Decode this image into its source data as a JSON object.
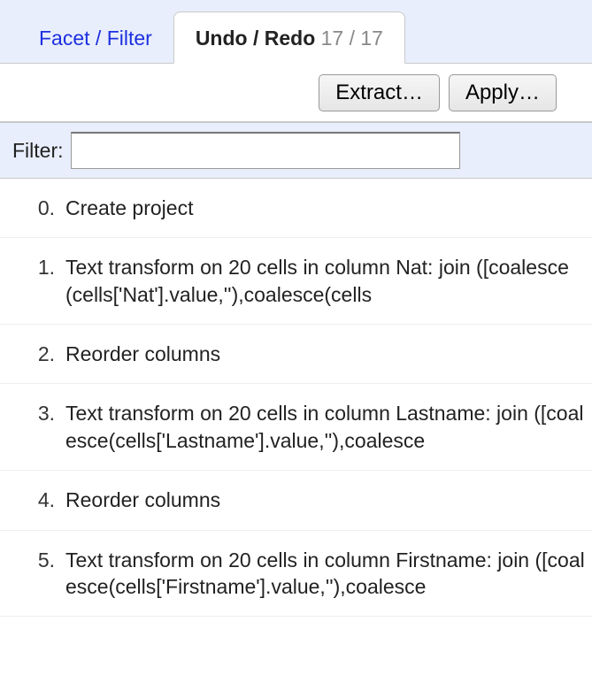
{
  "tabs": {
    "facet_filter": "Facet / Filter",
    "undo_redo": "Undo / Redo",
    "count": "17 / 17"
  },
  "toolbar": {
    "extract": "Extract…",
    "apply": "Apply…"
  },
  "filter": {
    "label": "Filter:",
    "value": ""
  },
  "history": [
    {
      "index": "0.",
      "text": "Create project"
    },
    {
      "index": "1.",
      "text": "Text transform on 20 cells in column Nat: join ([coalesce(cells['Nat'].value,''),coalesce(cells"
    },
    {
      "index": "2.",
      "text": "Reorder columns"
    },
    {
      "index": "3.",
      "text": "Text transform on 20 cells in column Lastname: join ([coalesce(cells['Lastname'].value,''),coalesce"
    },
    {
      "index": "4.",
      "text": "Reorder columns"
    },
    {
      "index": "5.",
      "text": "Text transform on 20 cells in column Firstname: join ([coalesce(cells['Firstname'].value,''),coalesce"
    }
  ]
}
